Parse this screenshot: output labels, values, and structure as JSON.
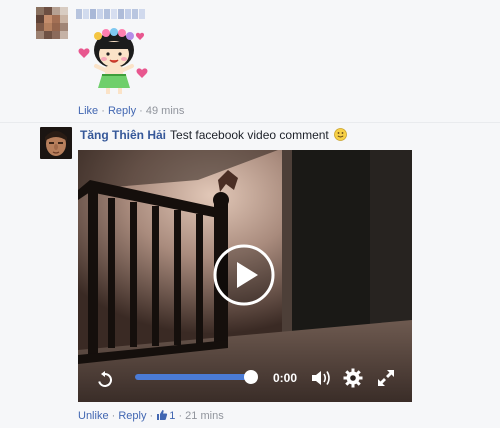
{
  "comment1": {
    "author_name": "",
    "actions": {
      "like": "Like",
      "reply": "Reply",
      "separator": " · ",
      "time": "49 mins"
    }
  },
  "comment2": {
    "author": "Tăng Thiên Hải",
    "text": "Test facebook video comment",
    "emoji": "smile-emoji",
    "video": {
      "time": "0:00",
      "progress": 1.0,
      "icons": [
        "replay-icon",
        "play-icon",
        "volume-icon",
        "settings-gear-icon",
        "fullscreen-icon"
      ]
    },
    "actions": {
      "unlike": "Unlike",
      "reply": "Reply",
      "like_count": "1",
      "separator": " · ",
      "time": "21 mins"
    }
  },
  "colors": {
    "link": "#4267b2",
    "author": "#365899",
    "meta": "#90949c",
    "progress": "#4a7bd6"
  }
}
